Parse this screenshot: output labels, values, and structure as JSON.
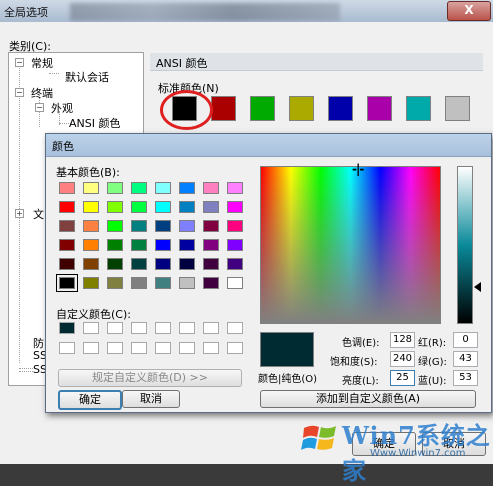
{
  "bg_window": {
    "title": "全局选项",
    "close_glyph": "X",
    "category_label": "类别(C):",
    "tree": [
      {
        "label": "常规",
        "toggle": "−"
      },
      {
        "label": "默认会话"
      },
      {
        "label": "终端",
        "toggle": "−"
      },
      {
        "label": "外观",
        "toggle": "−"
      },
      {
        "label": "ANSI 颜色"
      },
      {
        "label": "文",
        "toggle": "+"
      },
      {
        "label": "防"
      },
      {
        "label": "SS"
      },
      {
        "label": "SS"
      }
    ],
    "section_header": "ANSI 颜色",
    "standard_colors_label": "标准颜色(N)",
    "standard_colors": [
      "#000000",
      "#aa0000",
      "#00aa00",
      "#aaaa00",
      "#0000aa",
      "#aa00aa",
      "#00aaaa",
      "#c0c0c0"
    ],
    "ok_label": "确定",
    "cancel_label": "取消"
  },
  "color_dialog": {
    "title": "颜色",
    "basic_colors_label": "基本颜色(B):",
    "basic_colors": [
      [
        "#ff8080",
        "#ffff80",
        "#80ff80",
        "#00ff80",
        "#80ffff",
        "#0080ff",
        "#ff80c0",
        "#ff80ff"
      ],
      [
        "#ff0000",
        "#ffff00",
        "#80ff00",
        "#00ff40",
        "#00ffff",
        "#0080c0",
        "#8080c0",
        "#ff00ff"
      ],
      [
        "#804040",
        "#ff8040",
        "#00ff00",
        "#008080",
        "#004080",
        "#8080ff",
        "#800040",
        "#ff0080"
      ],
      [
        "#800000",
        "#ff8000",
        "#008000",
        "#008040",
        "#0000ff",
        "#0000a0",
        "#800080",
        "#8000ff"
      ],
      [
        "#400000",
        "#804000",
        "#004000",
        "#004040",
        "#000080",
        "#000040",
        "#400040",
        "#400080"
      ],
      [
        "#000000",
        "#808000",
        "#808040",
        "#808080",
        "#408080",
        "#c0c0c0",
        "#400040",
        "#ffffff"
      ]
    ],
    "selected_basic": [
      5,
      0
    ],
    "custom_colors_label": "自定义颜色(C):",
    "custom_colors": [
      [
        "#002b33",
        "#ffffff",
        "#ffffff",
        "#ffffff",
        "#ffffff",
        "#ffffff",
        "#ffffff",
        "#ffffff"
      ],
      [
        "#ffffff",
        "#ffffff",
        "#ffffff",
        "#ffffff",
        "#ffffff",
        "#ffffff",
        "#ffffff",
        "#ffffff"
      ]
    ],
    "define_custom_label": "规定自定义颜色(D) >>",
    "ok_label": "确定",
    "cancel_label": "取消",
    "solid_label": "颜色|纯色(O)",
    "hue_label": "色调(E):",
    "hue": "128",
    "sat_label": "饱和度(S):",
    "sat": "240",
    "lum_label": "亮度(L):",
    "lum": "25",
    "red_label": "红(R):",
    "red": "0",
    "green_label": "绿(G):",
    "green": "43",
    "blue_label": "蓝(U):",
    "blue": "53",
    "add_custom_label": "添加到自定义颜色(A)",
    "preview_color": "#002b33"
  },
  "watermark": {
    "brand": "Win7系统之家",
    "url": "Www.Winwin7.com"
  }
}
